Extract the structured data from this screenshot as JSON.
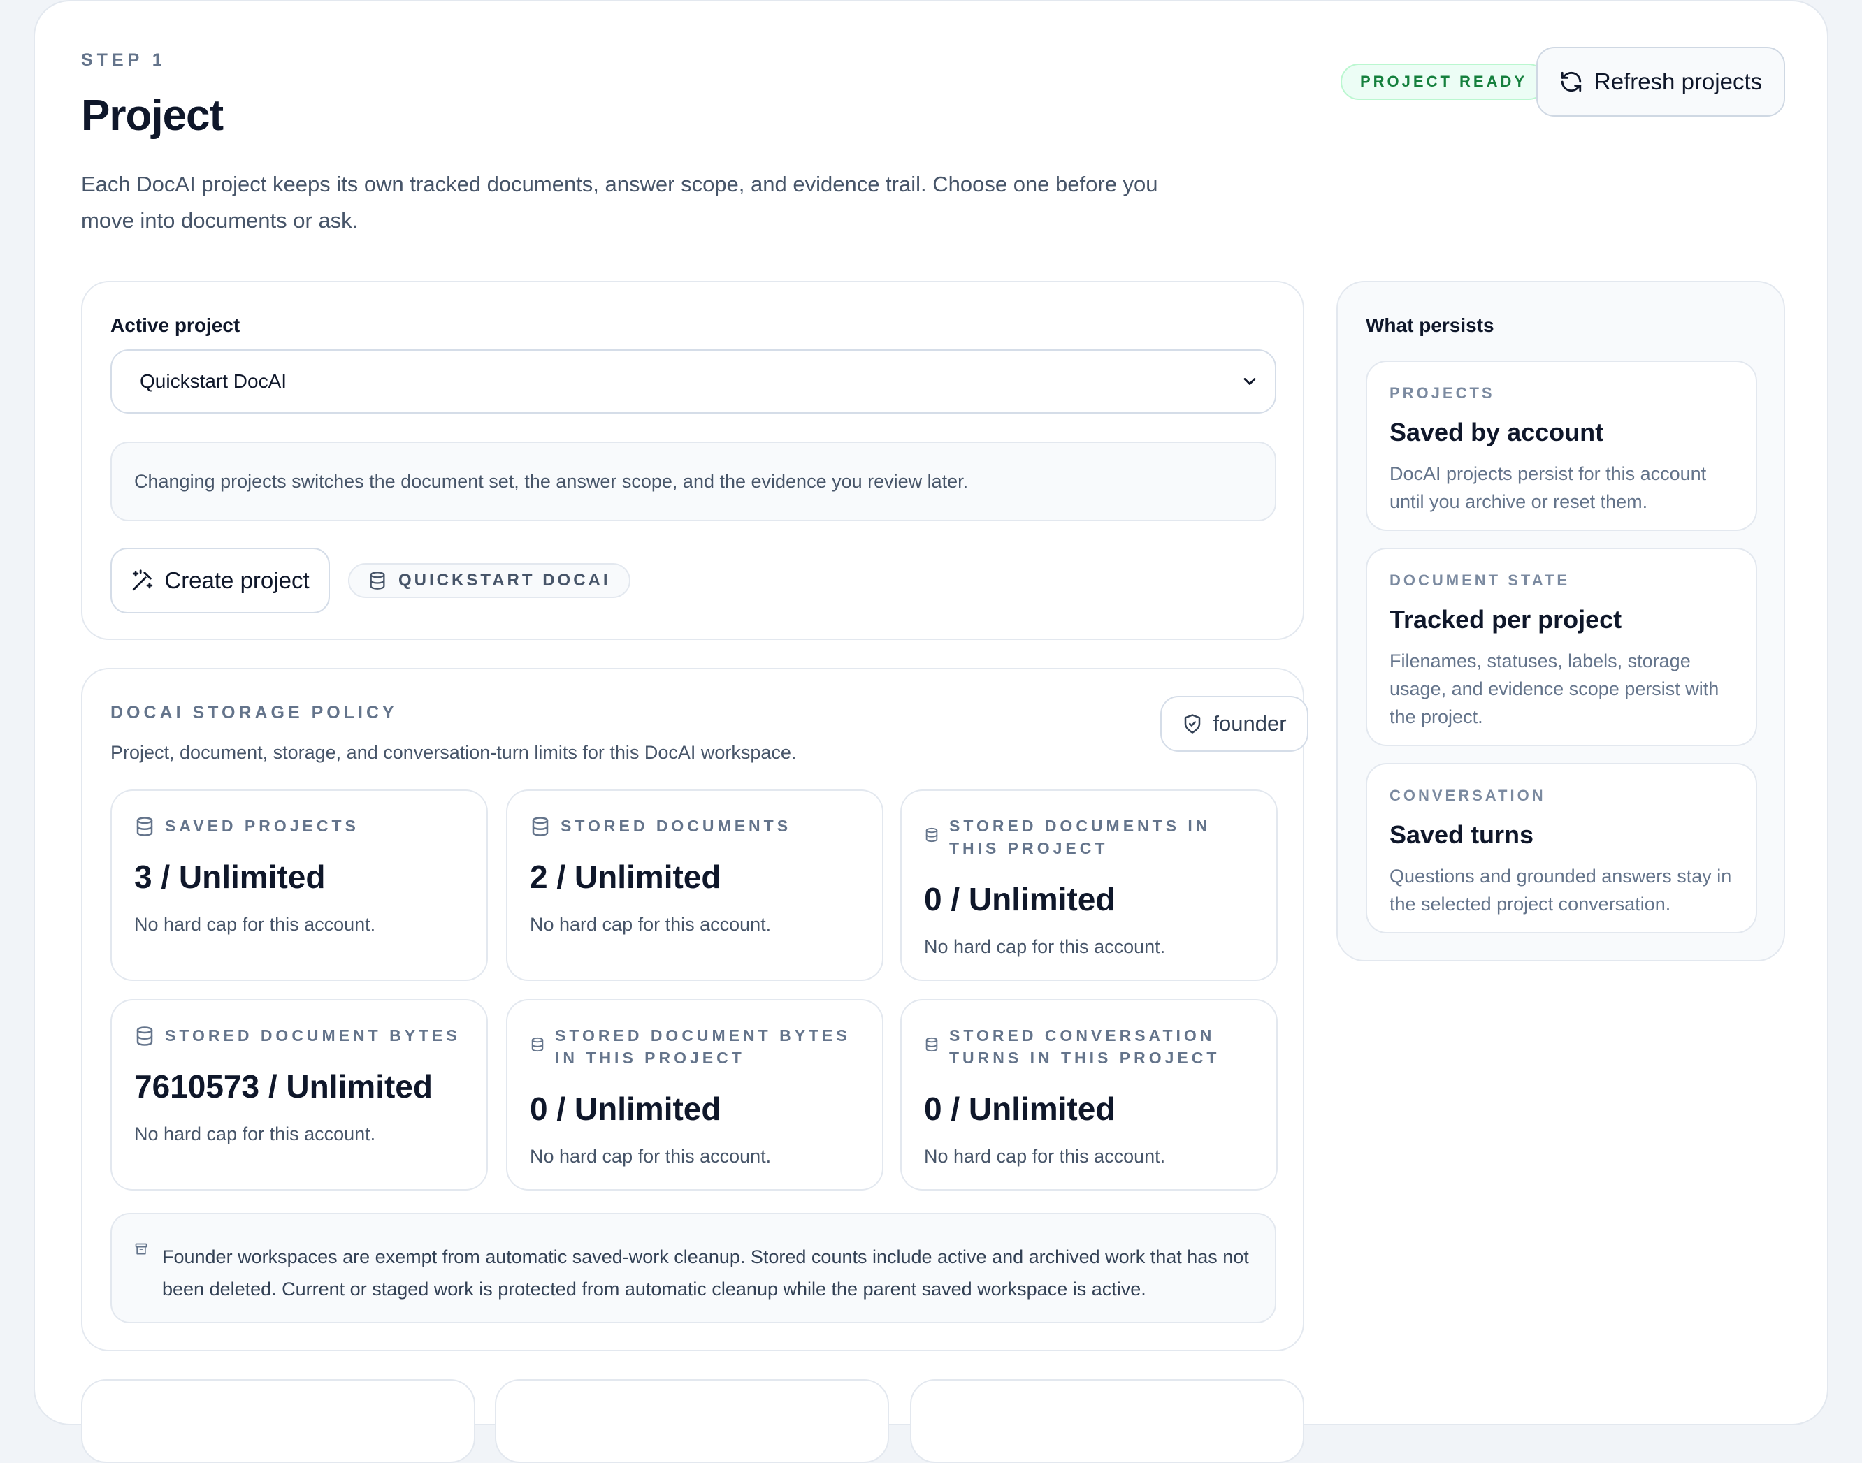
{
  "header": {
    "eyebrow": "STEP 1",
    "title": "Project",
    "description": "Each DocAI project keeps its own tracked documents, answer scope, and evidence trail. Choose one before you move into documents or ask.",
    "status_badge": "PROJECT READY",
    "refresh_label": "Refresh projects"
  },
  "active_project": {
    "label": "Active project",
    "selected": "Quickstart DocAI",
    "note": "Changing projects switches the document set, the answer scope, and the evidence you review later.",
    "create_label": "Create project",
    "project_pill": "QUICKSTART DOCAI"
  },
  "policy": {
    "title": "DOCAI STORAGE POLICY",
    "subtitle": "Project, document, storage, and conversation-turn limits for this DocAI workspace.",
    "role": "founder",
    "stats": [
      {
        "label": "SAVED PROJECTS",
        "value": "3 / Unlimited",
        "note": "No hard cap for this account."
      },
      {
        "label": "STORED DOCUMENTS",
        "value": "2 / Unlimited",
        "note": "No hard cap for this account."
      },
      {
        "label": "STORED DOCUMENTS IN THIS PROJECT",
        "value": "0 / Unlimited",
        "note": "No hard cap for this account."
      },
      {
        "label": "STORED DOCUMENT BYTES",
        "value": "7610573 / Unlimited",
        "note": "No hard cap for this account."
      },
      {
        "label": "STORED DOCUMENT BYTES IN THIS PROJECT",
        "value": "0 / Unlimited",
        "note": "No hard cap for this account."
      },
      {
        "label": "STORED CONVERSATION TURNS IN THIS PROJECT",
        "value": "0 / Unlimited",
        "note": "No hard cap for this account."
      }
    ],
    "cleanup_note": "Founder workspaces are exempt from automatic saved-work cleanup. Stored counts include active and archived work that has not been deleted. Current or staged work is protected from automatic cleanup while the parent saved workspace is active."
  },
  "persists": {
    "title": "What persists",
    "items": [
      {
        "label": "PROJECTS",
        "title": "Saved by account",
        "desc": "DocAI projects persist for this account until you archive or reset them."
      },
      {
        "label": "DOCUMENT STATE",
        "title": "Tracked per project",
        "desc": "Filenames, statuses, labels, storage usage, and evidence scope persist with the project."
      },
      {
        "label": "CONVERSATION",
        "title": "Saved turns",
        "desc": "Questions and grounded answers stay in the selected project conversation."
      }
    ]
  },
  "colors": {
    "accent_green": "#15803d",
    "muted_text": "#64748b",
    "border": "#e3e8ef"
  },
  "icons": {
    "refresh": "refresh-icon",
    "create": "magic-wand-icon",
    "database": "database-icon",
    "shield": "shield-check-icon",
    "chevron": "chevron-down-icon",
    "archive": "archive-icon"
  }
}
